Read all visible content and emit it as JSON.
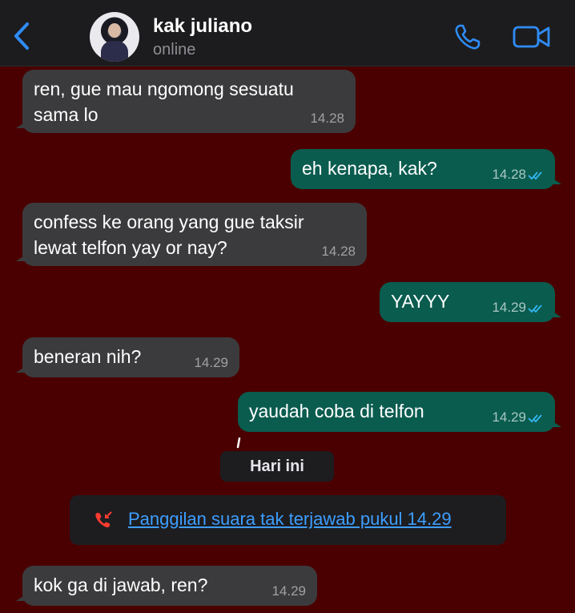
{
  "header": {
    "contact_name": "kak juliano",
    "status": "online",
    "icons": [
      "back-chevron-icon",
      "phone-icon",
      "video-camera-icon"
    ],
    "accent": "#2f8cf6"
  },
  "messages": [
    {
      "dir": "in",
      "text1": "ren, gue mau ngomong sesuatu",
      "text2": "sama lo",
      "time": "14.28"
    },
    {
      "dir": "out",
      "text": "eh kenapa, kak?",
      "time": "14.28",
      "read": true
    },
    {
      "dir": "in",
      "text1": "confess ke orang yang gue taksir",
      "text2": "lewat telfon yay or nay?",
      "time": "14.28"
    },
    {
      "dir": "out",
      "text": "YAYYY",
      "time": "14.29",
      "read": true
    },
    {
      "dir": "in",
      "text": "beneran nih?",
      "time": "14.29"
    },
    {
      "dir": "out",
      "text": "yaudah coba di telfon",
      "time": "14.29",
      "read": true
    },
    {
      "dir": "in",
      "text": "kok ga di jawab, ren?",
      "time": "14.29"
    }
  ],
  "day_divider": "Hari ini",
  "missed_call": {
    "text": "Panggilan suara tak terjawab pukul 14.29",
    "icon": "missed-call-icon",
    "color": "#ff3b30"
  },
  "colors": {
    "background": "#4a0000",
    "incoming_bubble": "#3b3b3d",
    "outgoing_bubble": "#0a5c4f",
    "read_ticks": "#34b7f1"
  }
}
